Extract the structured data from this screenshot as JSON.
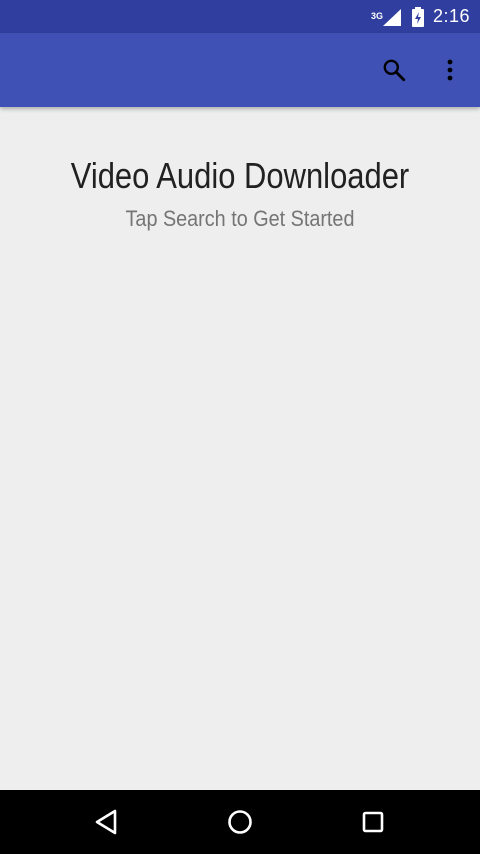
{
  "status_bar": {
    "network_type": "3G",
    "time": "2:16",
    "icons": [
      "signal-icon",
      "battery-charging-icon"
    ]
  },
  "app_bar": {
    "actions": [
      {
        "icon": "search-icon"
      },
      {
        "icon": "more-vert-icon"
      }
    ]
  },
  "main": {
    "title": "Video Audio Downloader",
    "subtitle": "Tap Search to Get Started"
  },
  "nav_bar": {
    "buttons": [
      "back-icon",
      "home-icon",
      "recents-icon"
    ]
  },
  "colors": {
    "status_bar": "#303F9F",
    "app_bar": "#3F51B5",
    "background": "#EEEEEE",
    "title_text": "#212121",
    "subtitle_text": "#757575",
    "nav_bar": "#000000"
  }
}
